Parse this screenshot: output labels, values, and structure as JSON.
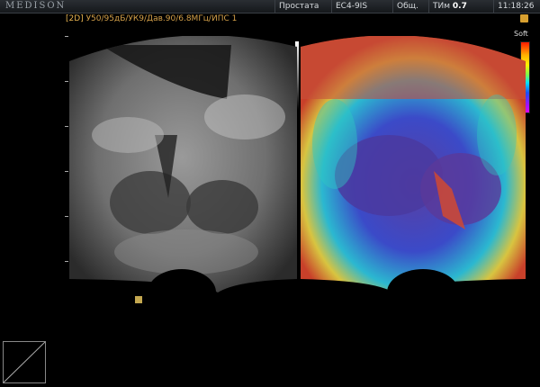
{
  "header": {
    "brand": "MEDISON",
    "preset": "Простата",
    "probe": "EC4-9IS",
    "mode": "Общ.",
    "tim_label": "ТИм",
    "tim_value": "0.7",
    "time": "11:18:26"
  },
  "params": {
    "mode_tag": "[2D]",
    "text": "У50/95дБ/УК9/Дав.90/6.8МГц/",
    "extra": "ИПС 1"
  },
  "elasto": {
    "label": "Soft"
  },
  "depth": {
    "marker": "5"
  },
  "colors": {
    "accent": "#d6a24a",
    "background": "#000000"
  }
}
